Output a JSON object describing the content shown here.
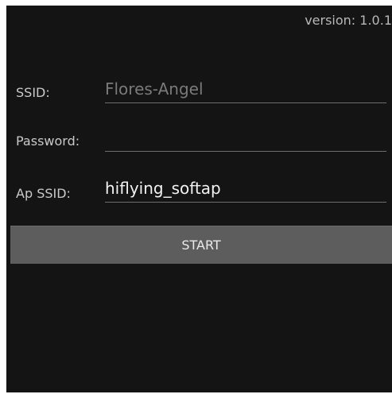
{
  "header": {
    "version_text": "version: 1.0.1"
  },
  "form": {
    "ssid": {
      "label": "SSID:",
      "value": "",
      "placeholder": "Flores-Angel"
    },
    "password": {
      "label": "Password:",
      "value": "",
      "placeholder": ""
    },
    "ap_ssid": {
      "label": "Ap SSID:",
      "value": "hiflying_softap"
    }
  },
  "actions": {
    "start_label": "START"
  },
  "colors": {
    "background": "#141414",
    "button": "#5d5d5d",
    "placeholder": "#7a7a7a",
    "text": "#f2f2f2"
  }
}
